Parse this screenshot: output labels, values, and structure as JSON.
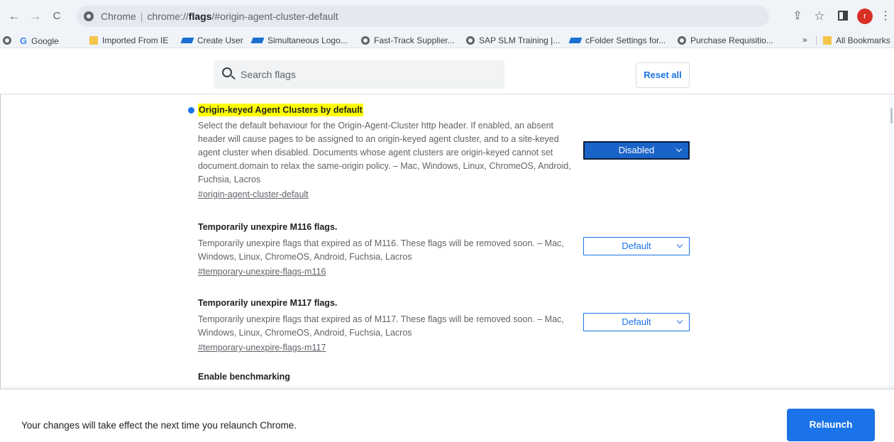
{
  "toolbar": {
    "back_icon": "←",
    "forward_icon": "→",
    "reload_icon": "C",
    "url_origin": "Chrome",
    "url_separator": "|",
    "url_scheme": "chrome://",
    "url_host": "flags",
    "url_path": "/#origin-agent-cluster-default",
    "share_icon": "⇪",
    "star_icon": "☆",
    "profile_initial": "r",
    "menu_icon": "⋮"
  },
  "bookmarks": {
    "items": [
      {
        "label": "Google",
        "icon": "google-icon"
      },
      {
        "label": "Imported From IE",
        "icon": "folder-icon"
      },
      {
        "label": "Create User",
        "icon": "sap-icon"
      },
      {
        "label": "Simultaneous Logo...",
        "icon": "sap-icon"
      },
      {
        "label": "Fast-Track Supplier...",
        "icon": "globe-icon"
      },
      {
        "label": "SAP SLM Training |...",
        "icon": "globe-icon"
      },
      {
        "label": "cFolder Settings for...",
        "icon": "sap-icon"
      },
      {
        "label": "Purchase Requisitio...",
        "icon": "globe-icon"
      }
    ],
    "overflow": "»",
    "all_bookmarks": "All Bookmarks"
  },
  "search": {
    "placeholder": "Search flags"
  },
  "reset_label": "Reset all",
  "experiments": [
    {
      "title": "Origin-keyed Agent Clusters by default",
      "description": "Select the default behaviour for the Origin-Agent-Cluster http header. If enabled, an absent header will cause pages to be assigned to an origin-keyed agent cluster, and to a site-keyed agent cluster when disabled. Documents whose agent clusters are origin-keyed cannot set document.domain to relax the same-origin policy. – Mac, Windows, Linux, ChromeOS, Android, Fuchsia, Lacros",
      "link": "#origin-agent-cluster-default",
      "value": "Disabled"
    },
    {
      "title": "Temporarily unexpire M116 flags.",
      "description": "Temporarily unexpire flags that expired as of M116. These flags will be removed soon. – Mac, Windows, Linux, ChromeOS, Android, Fuchsia, Lacros",
      "link": "#temporary-unexpire-flags-m116",
      "value": "Default"
    },
    {
      "title": "Temporarily unexpire M117 flags.",
      "description": "Temporarily unexpire flags that expired as of M117. These flags will be removed soon. – Mac, Windows, Linux, ChromeOS, Android, Fuchsia, Lacros",
      "link": "#temporary-unexpire-flags-m117",
      "value": "Default"
    },
    {
      "title": "Enable benchmarking"
    }
  ],
  "relaunch": {
    "message": "Your changes will take effect the next time you relaunch Chrome.",
    "button": "Relaunch"
  },
  "colors": {
    "accent": "#1a73e8",
    "highlight": "#ffff00",
    "modified_dot": "#1a73e8",
    "profile": "#d93025"
  }
}
